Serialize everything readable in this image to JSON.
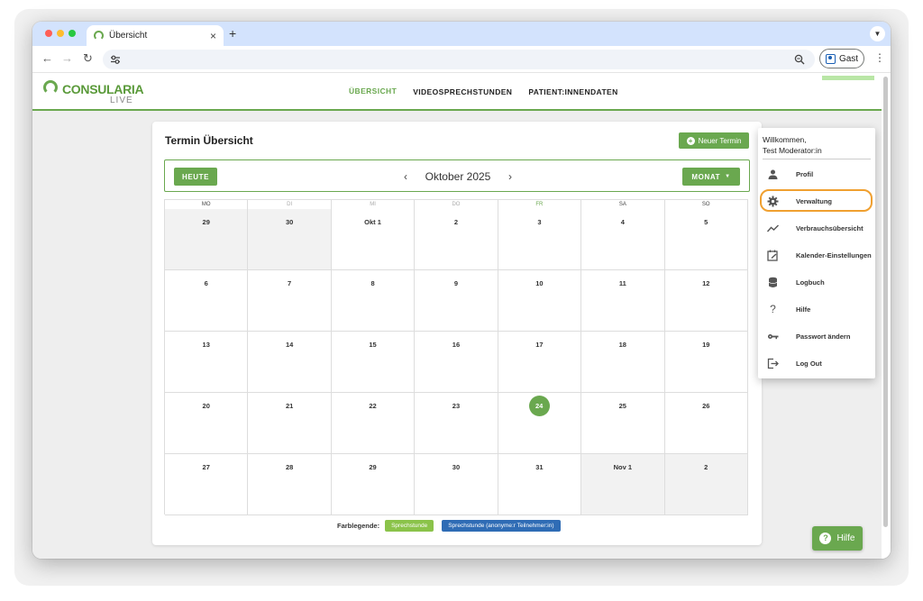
{
  "browser": {
    "tab_title": "Übersicht",
    "tab_close": "×",
    "new_tab": "+",
    "profile_label": "Gast"
  },
  "app": {
    "logo_text": "CONSULARIA",
    "logo_sub": "LIVE",
    "nav": [
      {
        "label": "ÜBERSICHT",
        "active": true
      },
      {
        "label": "VIDEOSPRECHSTUNDEN",
        "active": false
      },
      {
        "label": "PATIENT:INNENDATEN",
        "active": false
      }
    ]
  },
  "calendar": {
    "title": "Termin Übersicht",
    "new_button": "Neuer Termin",
    "today_button": "HEUTE",
    "month_label": "Oktober 2025",
    "view_button": "MONAT",
    "weekdays": [
      "MO",
      "DI",
      "MI",
      "DO",
      "FR",
      "SA",
      "SO"
    ],
    "weeks": [
      [
        "29",
        "30",
        "Okt 1",
        "2",
        "3",
        "4",
        "5"
      ],
      [
        "6",
        "7",
        "8",
        "9",
        "10",
        "11",
        "12"
      ],
      [
        "13",
        "14",
        "15",
        "16",
        "17",
        "18",
        "19"
      ],
      [
        "20",
        "21",
        "22",
        "23",
        "24",
        "25",
        "26"
      ],
      [
        "27",
        "28",
        "29",
        "30",
        "31",
        "Nov 1",
        "2"
      ]
    ],
    "today": "24",
    "legend_label": "Farblegende:",
    "legend": [
      "Sprechstunde",
      "Sprechstunde (anonyme:r Teilnehmer:in)"
    ],
    "colors": {
      "accent": "#6aa84f",
      "legend1": "#8bc34a",
      "legend2": "#2f6cb5"
    }
  },
  "help_button": "Hilfe",
  "user_menu": {
    "welcome_line1": "Willkommen,",
    "welcome_line2": "Test Moderator:in",
    "items": [
      {
        "label": "Profil",
        "icon": "person-icon"
      },
      {
        "label": "Verwaltung",
        "icon": "gear-icon"
      },
      {
        "label": "Verbrauchsübersicht",
        "icon": "trend-icon"
      },
      {
        "label": "Kalender-Einstellungen",
        "icon": "calendar-edit-icon"
      },
      {
        "label": "Logbuch",
        "icon": "database-icon"
      },
      {
        "label": "Hilfe",
        "icon": "question-icon"
      },
      {
        "label": "Passwort ändern",
        "icon": "key-icon"
      },
      {
        "label": "Log Out",
        "icon": "logout-icon"
      }
    ]
  }
}
